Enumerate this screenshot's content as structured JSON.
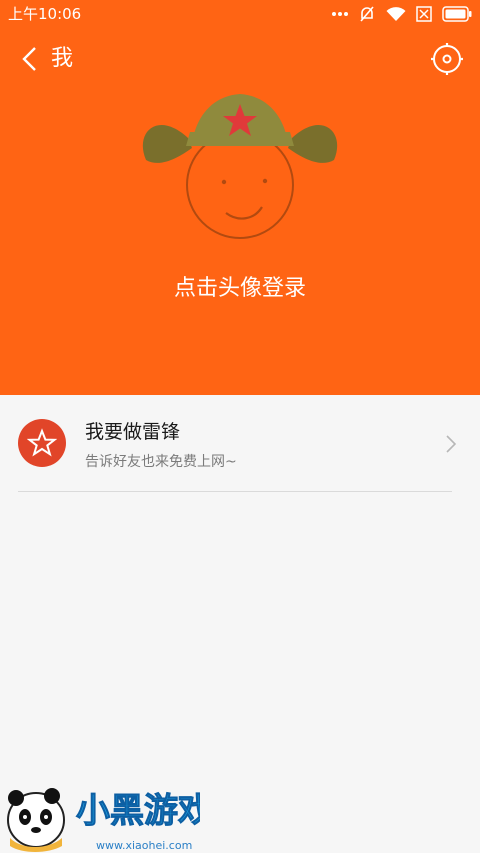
{
  "status": {
    "time": "上午10:06",
    "icons": [
      "more-dots-icon",
      "alarm-off-icon",
      "wifi-icon",
      "sim-off-icon",
      "battery-icon"
    ]
  },
  "header": {
    "title": "我",
    "login_text": "点击头像登录",
    "settings_icon": "gear-icon"
  },
  "feature": {
    "title": "我要做雷锋",
    "subtitle": "告诉好友也来免费上网~"
  },
  "watermark": {
    "text": "小黑游戏",
    "url": "www.xiaohei.com"
  },
  "colors": {
    "header_bg": "#ff6414",
    "badge_bg": "#e14529"
  }
}
